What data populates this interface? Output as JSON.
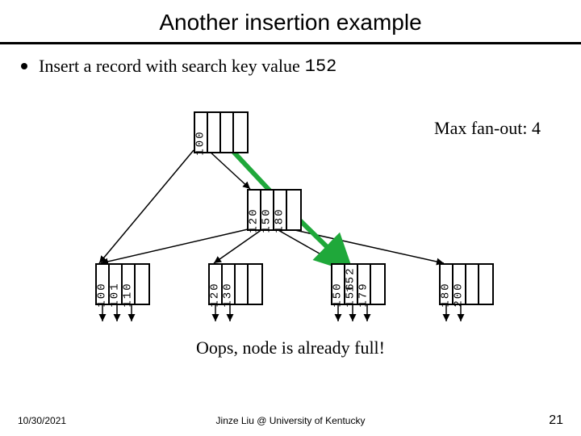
{
  "title": "Another insertion example",
  "bullet": {
    "prefix": "Insert a record with search key value ",
    "key": "152"
  },
  "fanout_label": "Max fan-out: 4",
  "root": {
    "cells": [
      "100",
      "",
      "",
      ""
    ]
  },
  "index": {
    "cells": [
      "120",
      "150",
      "180",
      ""
    ]
  },
  "insert_value": "152",
  "leaves": [
    {
      "cells": [
        "100",
        "101",
        "110",
        ""
      ]
    },
    {
      "cells": [
        "120",
        "130",
        "",
        ""
      ]
    },
    {
      "cells": [
        "150",
        "156",
        "179",
        ""
      ]
    },
    {
      "cells": [
        "180",
        "200",
        "",
        ""
      ]
    }
  ],
  "oops": "Oops, node is already full!",
  "footer": {
    "date": "10/30/2021",
    "credit": "Jinze Liu @ University of Kentucky",
    "page": "21"
  },
  "chart_data": {
    "type": "diagram",
    "description": "B+ tree insertion example, fan-out 4",
    "insert_key": 152,
    "max_fanout": 4,
    "root_keys": [
      100
    ],
    "internal_keys": [
      120,
      150,
      180
    ],
    "leaves": [
      [
        100,
        101,
        110
      ],
      [
        120,
        130
      ],
      [
        150,
        156,
        179
      ],
      [
        180,
        200
      ]
    ],
    "target_leaf_index": 2,
    "full_leaf": true
  }
}
